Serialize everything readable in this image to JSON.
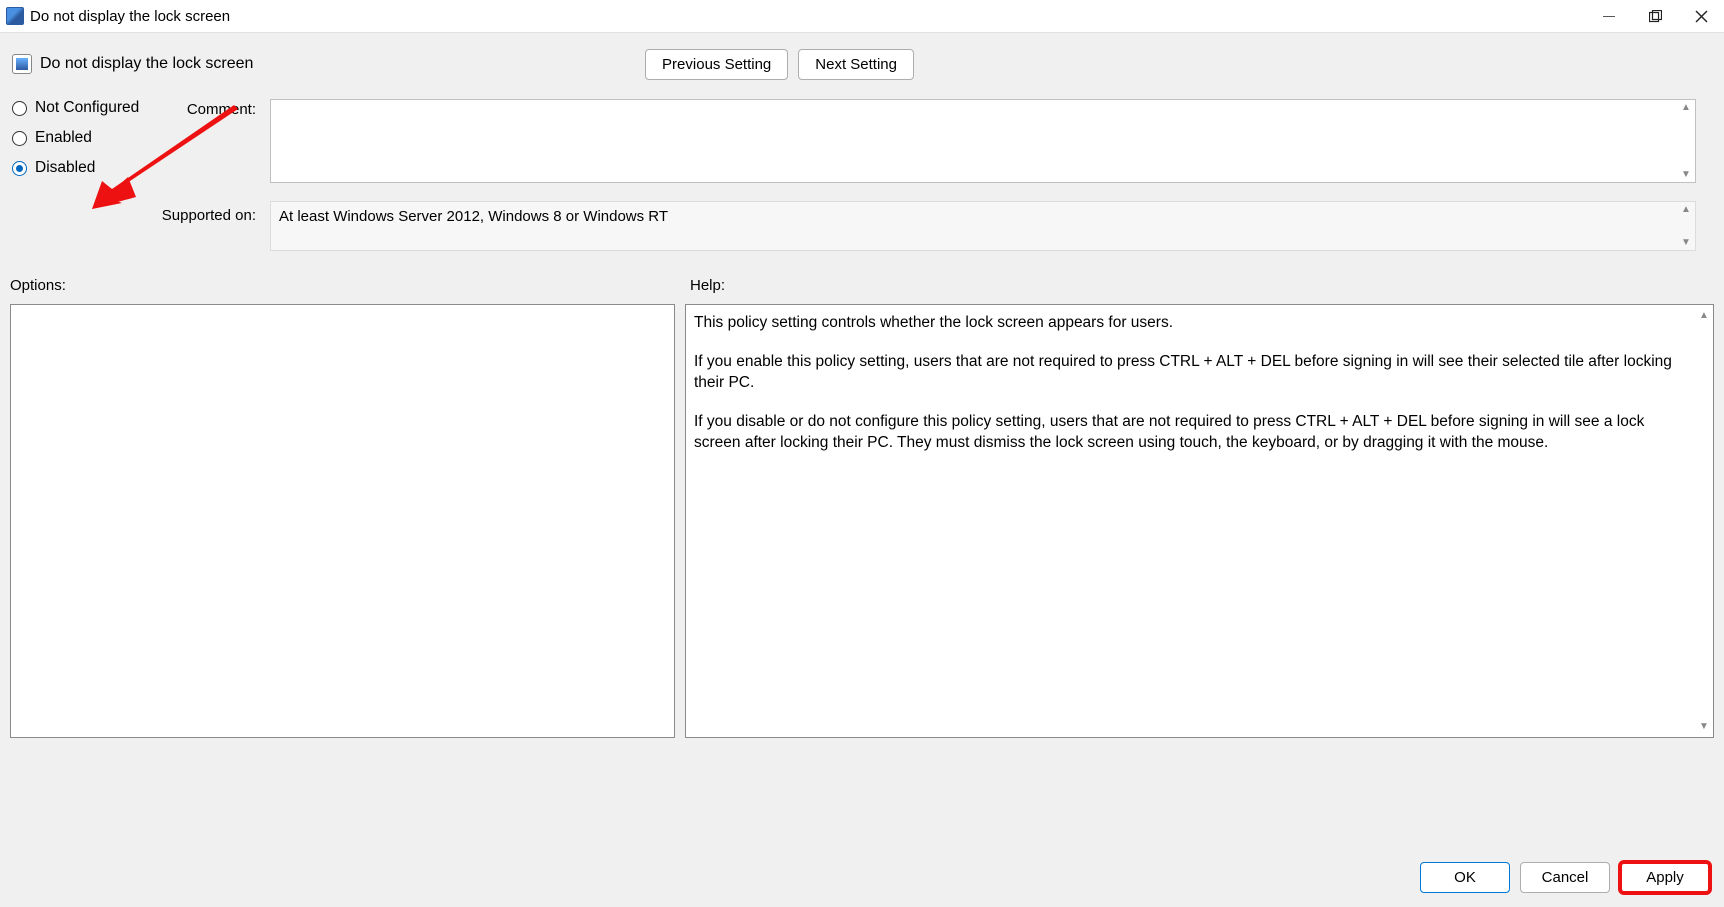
{
  "window": {
    "title": "Do not display the lock screen"
  },
  "header": {
    "policy_name": "Do not display the lock screen",
    "prev_btn": "Previous Setting",
    "next_btn": "Next Setting"
  },
  "state": {
    "radios": {
      "not_configured": "Not Configured",
      "enabled": "Enabled",
      "disabled": "Disabled",
      "selected": "disabled"
    },
    "comment_label": "Comment:",
    "comment_value": "",
    "supported_label": "Supported on:",
    "supported_value": "At least Windows Server 2012, Windows 8 or Windows RT"
  },
  "labels": {
    "options": "Options:",
    "help": "Help:"
  },
  "help": {
    "p1": "This policy setting controls whether the lock screen appears for users.",
    "p2": "If you enable this policy setting, users that are not required to press CTRL + ALT + DEL before signing in will see their selected tile after locking their PC.",
    "p3": "If you disable or do not configure this policy setting, users that are not required to press CTRL + ALT + DEL before signing in will see a lock screen after locking their PC. They must dismiss the lock screen using touch, the keyboard, or by dragging it with the mouse."
  },
  "footer": {
    "ok": "OK",
    "cancel": "Cancel",
    "apply": "Apply"
  },
  "annotations": {
    "arrow_target": "radio-disabled",
    "highlight_target": "apply-button"
  }
}
